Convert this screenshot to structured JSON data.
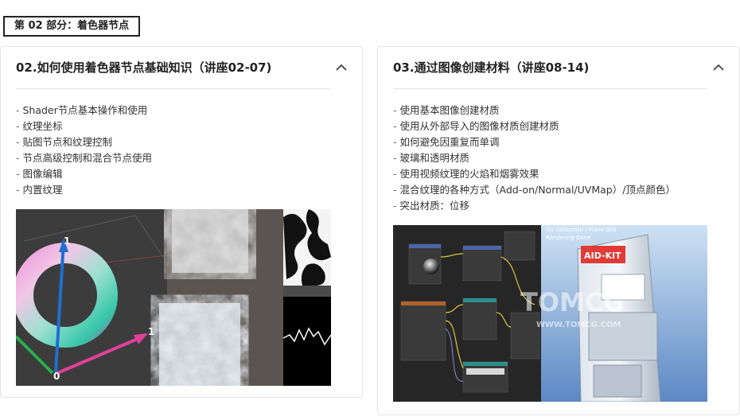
{
  "section_tag": "第 02 部分：着色器节点",
  "cards": [
    {
      "title": "02.如何使用着色器节点基础知识（讲座02-07)",
      "toggle_icon": "chevron-up-icon",
      "items": [
        "Shader节点基本操作和使用",
        "纹理坐标",
        "贴图节点和纹理控制",
        "节点高级控制和混合节点使用",
        "图像编辑",
        "内置纹理"
      ],
      "image_labels": [
        "1",
        "1",
        "0"
      ]
    },
    {
      "title": "03.通过图像创建材料（讲座08-14)",
      "toggle_icon": "chevron-up-icon",
      "items": [
        "使用基本图像创建材质",
        "使用从外部导入的图像材质创建材质",
        "如何避免因重复而单调",
        "玻璃和透明材质",
        "使用视频纹理的火焰和烟雾效果",
        "混合纹理的各种方式（Add-on/Normal/UVMap）/顶点颜色）",
        "突出材质：位移"
      ],
      "image_labels": {
        "viewport_header": "(0) Collection | Plane.003",
        "viewport_sub": "Rendering Done",
        "machine_sign": "AID-KIT",
        "watermark": "TOMCG",
        "watermark_url": "WWW.TOMCG.COM"
      }
    }
  ]
}
